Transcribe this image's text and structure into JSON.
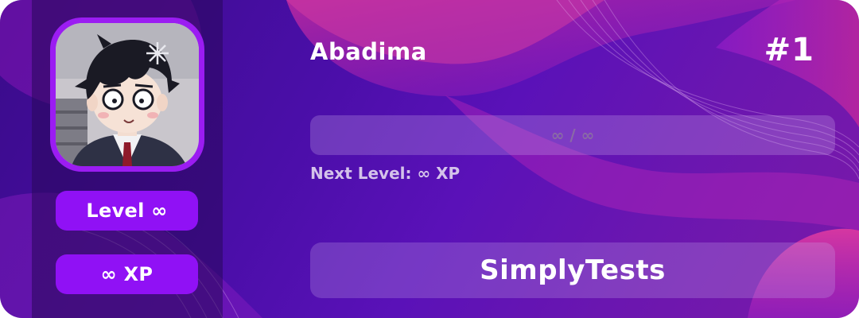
{
  "user": {
    "name": "Abadima",
    "rank": "#1",
    "level_label": "Level ∞",
    "xp_label": "∞ XP"
  },
  "progress": {
    "text": "∞ / ∞",
    "fraction": 0,
    "next_level": "Next Level: ∞ XP"
  },
  "server": {
    "name": "SimplyTests"
  },
  "colors": {
    "accent": "#9011f5",
    "background": "#4a0ea8",
    "text": "#ffffff"
  },
  "icons": {
    "avatar": "anime-character-avatar"
  }
}
